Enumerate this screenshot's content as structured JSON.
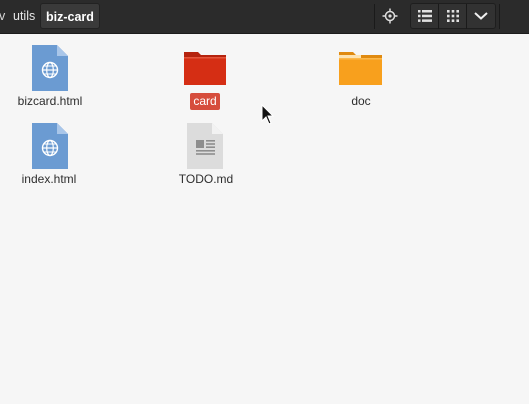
{
  "header": {
    "breadcrumbs": [
      {
        "label": "v"
      },
      {
        "label": "utils"
      },
      {
        "label": "biz-card"
      }
    ],
    "buttons": {
      "locate_icon": "crosshair-icon",
      "list_view_icon": "list-view-icon",
      "grid_view_icon": "grid-view-icon",
      "menu_icon": "chevron-down-icon"
    }
  },
  "files": [
    {
      "name": "bizcard.html",
      "type": "html",
      "selected": false
    },
    {
      "name": "card",
      "type": "folder",
      "color": "#d52e14",
      "selected": true
    },
    {
      "name": "doc",
      "type": "folder",
      "color": "#f8a01d",
      "selected": false
    },
    {
      "name": "index.html",
      "type": "html",
      "selected": false
    },
    {
      "name": "TODO.md",
      "type": "text",
      "selected": false
    }
  ],
  "colors": {
    "header_bg": "#2b2b2b",
    "content_bg": "#f6f6f6",
    "selection": "#d64d3c",
    "html_icon": "#6b9bd2"
  }
}
